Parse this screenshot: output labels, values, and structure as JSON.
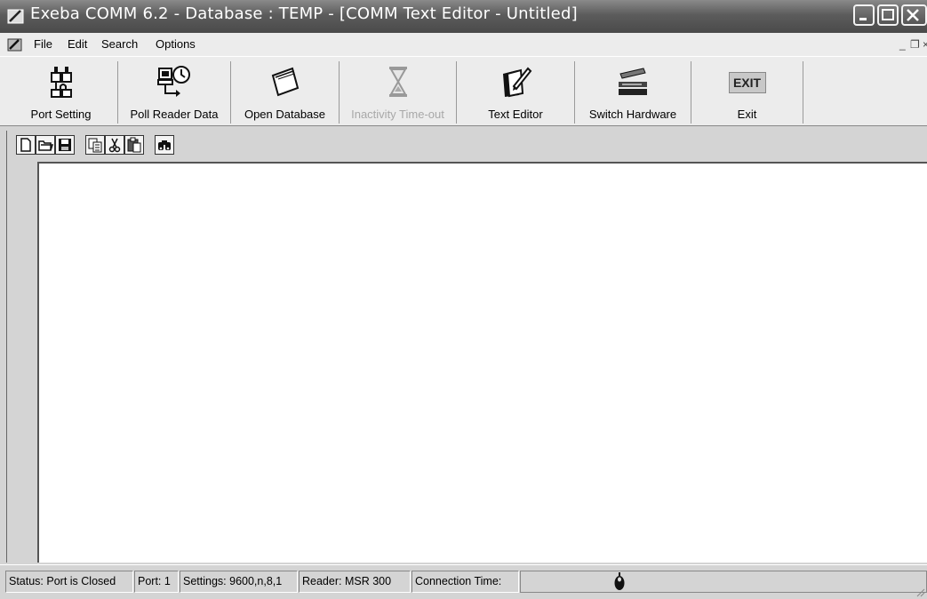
{
  "window": {
    "title": "Exeba COMM 6.2 - Database : TEMP - [COMM Text Editor - Untitled]"
  },
  "menu": {
    "items": [
      "File",
      "Edit",
      "Search",
      "Options"
    ]
  },
  "toolbar": {
    "buttons": [
      {
        "label": "Port Setting",
        "icon": "port-setting-icon",
        "enabled": true
      },
      {
        "label": "Poll Reader Data",
        "icon": "poll-reader-icon",
        "enabled": true
      },
      {
        "label": "Open Database",
        "icon": "open-database-icon",
        "enabled": true
      },
      {
        "label": "Inactivity Time-out",
        "icon": "hourglass-icon",
        "enabled": false
      },
      {
        "label": "Text Editor",
        "icon": "text-editor-icon",
        "enabled": true
      },
      {
        "label": "Switch Hardware",
        "icon": "card-reader-icon",
        "enabled": true
      },
      {
        "label": "Exit",
        "icon": "exit-icon",
        "icon_text": "EXIT",
        "enabled": true
      }
    ]
  },
  "editor": {
    "mini_toolbar": [
      "new-file-icon",
      "open-folder-icon",
      "save-icon",
      "copy-icon",
      "cut-icon",
      "paste-icon",
      "find-icon"
    ],
    "content": ""
  },
  "statusbar": {
    "status": "Status: Port is Closed",
    "port": "Port: 1",
    "settings": "Settings: 9600,n,8,1",
    "reader": "Reader: MSR 300",
    "connection": "Connection Time:"
  }
}
